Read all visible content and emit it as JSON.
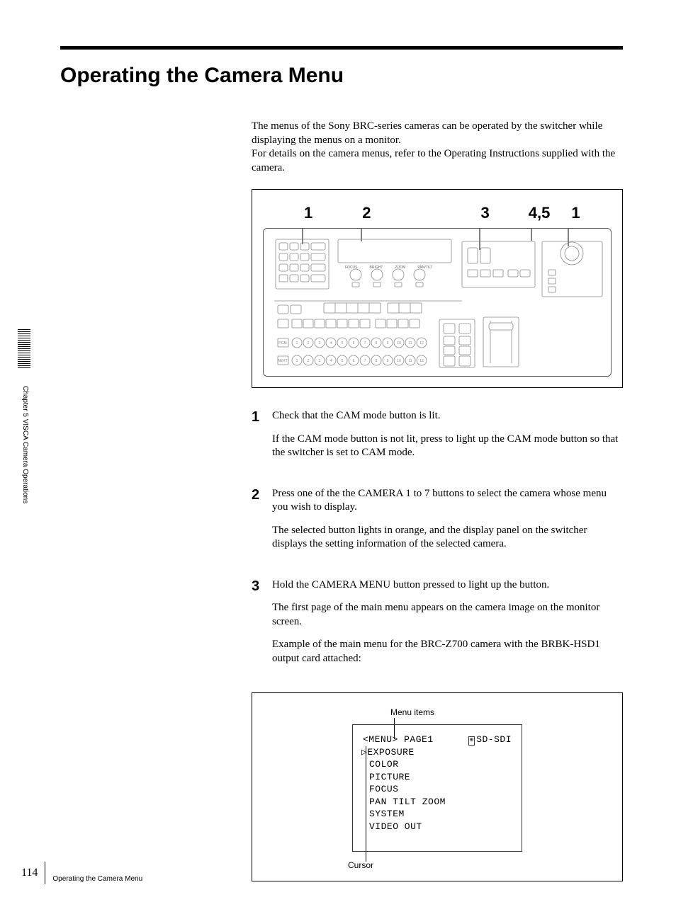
{
  "title": "Operating the Camera Menu",
  "intro_p1": "The menus of the Sony BRC-series cameras can be operated by the switcher while displaying the menus on a monitor.",
  "intro_p2": "For details on the camera menus, refer to the Operating Instructions supplied with the camera.",
  "callouts": {
    "a": "1",
    "b": "2",
    "c": "3",
    "d": "4,5",
    "e": "1"
  },
  "panel_joystick_labels": [
    "FOCUS",
    "BRIGHT",
    "ZOOM",
    "PAN/TILT"
  ],
  "steps": [
    {
      "num": "1",
      "paras": [
        "Check that the CAM mode button is lit.",
        "If the CAM mode button is not lit, press to light up the CAM mode button so that the switcher is set to CAM mode."
      ]
    },
    {
      "num": "2",
      "paras": [
        "Press one of the the CAMERA 1 to 7 buttons to select the camera whose menu you wish to display.",
        "The selected button lights in orange, and the display panel on the switcher displays the setting information of the selected camera."
      ]
    },
    {
      "num": "3",
      "paras": [
        "Hold the CAMERA MENU button pressed to light up the button.",
        "The first page of the main menu appears on the camera image on the monitor screen.",
        "Example of the main menu for the BRC-Z700 camera with the BRBK-HSD1 output card attached:"
      ]
    }
  ],
  "example": {
    "menu_items_label": "Menu items",
    "cursor_label": "Cursor",
    "header_left": "<MENU>",
    "header_mid": "PAGE1",
    "header_right": "SD-SDI",
    "items": [
      "EXPOSURE",
      "COLOR",
      "PICTURE",
      "FOCUS",
      "PAN TILT ZOOM",
      "SYSTEM",
      "VIDEO OUT"
    ]
  },
  "sidebar_chapter": "Chapter 5  VISCA Camera Operations",
  "footer": {
    "page_num": "114",
    "section": "Operating the Camera Menu"
  }
}
